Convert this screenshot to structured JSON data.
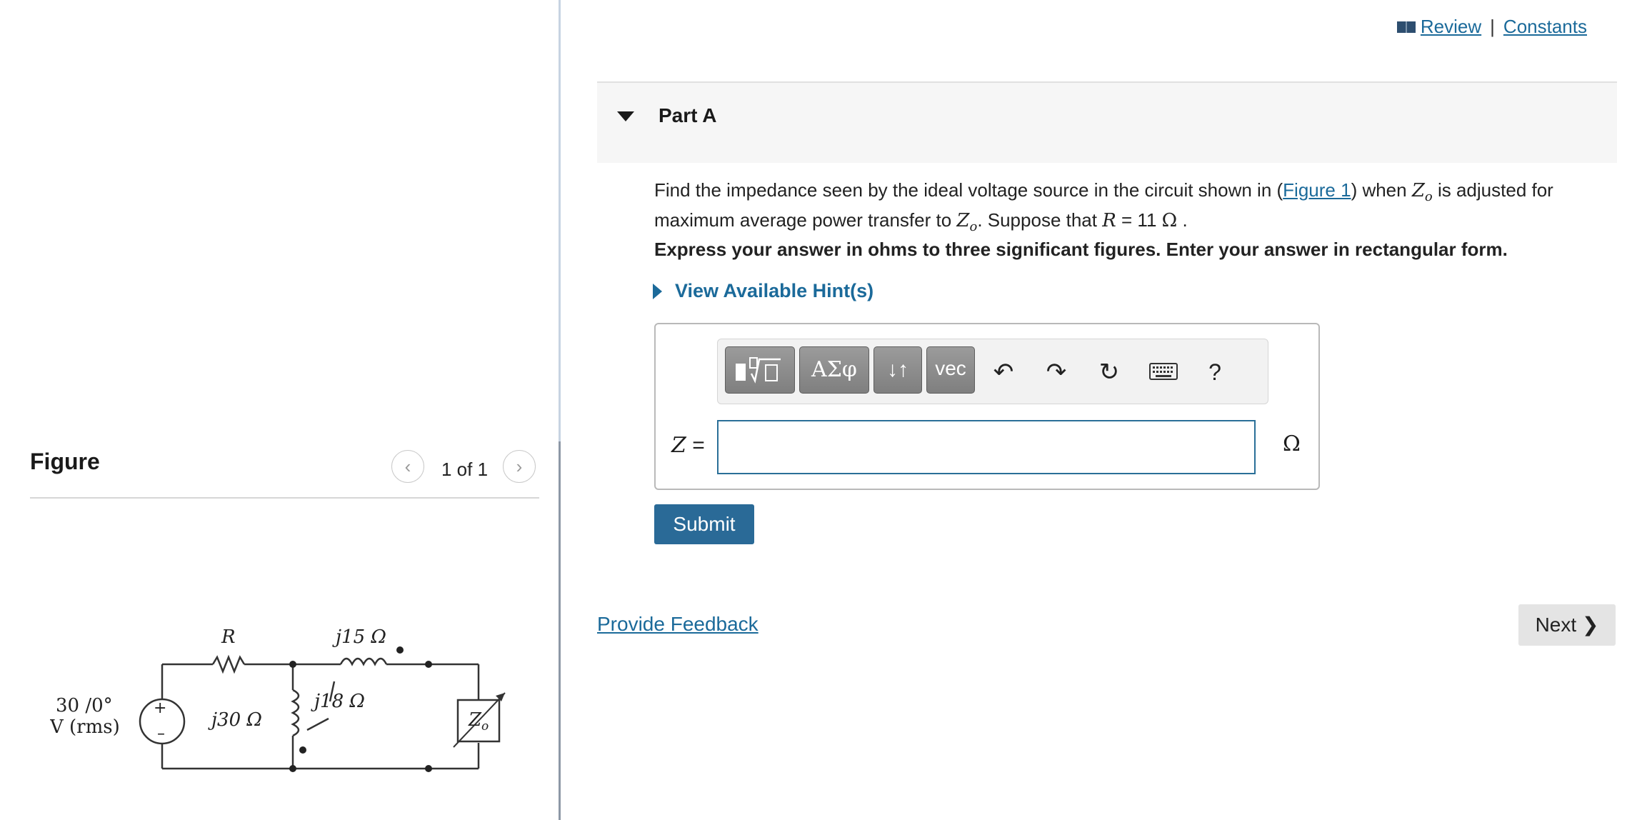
{
  "header": {
    "review_label": "Review",
    "separator": "|",
    "constants_label": "Constants"
  },
  "figure_panel": {
    "title": "Figure",
    "pager_text": "1 of 1",
    "circuit_labels": {
      "source_value": "30 /0°",
      "source_unit": "V (rms)",
      "resistor": "R",
      "series_inductor": "j15 Ω",
      "shunt_inductor": "j30 Ω",
      "mutual": "j18 Ω",
      "load": "Z",
      "load_subscript": "o"
    }
  },
  "part": {
    "title": "Part A"
  },
  "question": {
    "text_1": "Find the impedance seen by the ideal voltage source in the circuit shown in (",
    "figure_link": "Figure 1",
    "text_2": ") when ",
    "zo": "Z",
    "zo_sub": "o",
    "text_3": " is adjusted for maximum average power transfer to ",
    "text_4": ". Suppose that ",
    "r_var": "R",
    "r_eq": " = 11 ",
    "omega": "Ω",
    "end": " .",
    "instruction": "Express your answer in ohms to three significant figures. Enter your answer in rectangular form.",
    "hint_label": "View Available Hint(s)"
  },
  "answer": {
    "variable": "Z",
    "equals": "=",
    "value": "",
    "unit": "Ω",
    "toolbar": {
      "greek_label": "ΑΣφ",
      "arrows_label": "↓↑",
      "vec_label": "vec",
      "help_label": "?"
    }
  },
  "actions": {
    "submit_label": "Submit",
    "feedback_label": "Provide Feedback",
    "next_label": "Next"
  },
  "colors": {
    "link": "#1b6a9a",
    "submit": "#2a6a97",
    "input_border": "#2a6f98"
  }
}
